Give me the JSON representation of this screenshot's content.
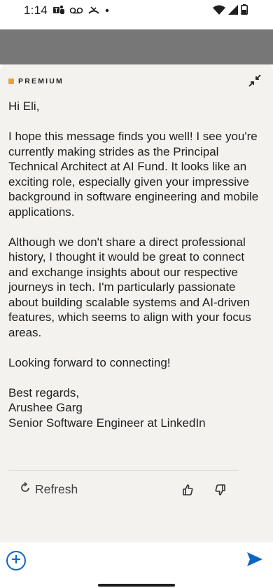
{
  "status_bar": {
    "time": "1:14",
    "icons_left": [
      "teams-icon",
      "voicemail-icon",
      "missed-call-icon",
      "dot-icon"
    ],
    "icons_right": [
      "wifi-icon",
      "signal-icon",
      "battery-icon"
    ]
  },
  "header": {
    "premium_label": "PREMIUM",
    "collapse_icon": "collapse-icon"
  },
  "message": {
    "greeting": "Hi Eli,",
    "paragraph1": "I hope this message finds you well! I see you're currently making strides as the Principal Technical Architect at AI Fund. It looks like an exciting role, especially given your impressive background in software engineering and mobile applications.",
    "paragraph2": "Although we don't share a direct professional history, I thought it would be great to connect and exchange insights about our respective journeys in tech. I'm particularly passionate about building scalable systems and AI-driven features, which seems to align with your focus areas.",
    "closing": "Looking forward to connecting!",
    "signoff_line1": "Best regards,",
    "signoff_line2": "Arushee Garg",
    "signoff_line3": "Senior Software Engineer at LinkedIn"
  },
  "actions": {
    "refresh_label": "Refresh"
  },
  "colors": {
    "accent": "#0a66c2",
    "premium": "#e7a33e",
    "sheet_bg": "#f3f2ef"
  }
}
